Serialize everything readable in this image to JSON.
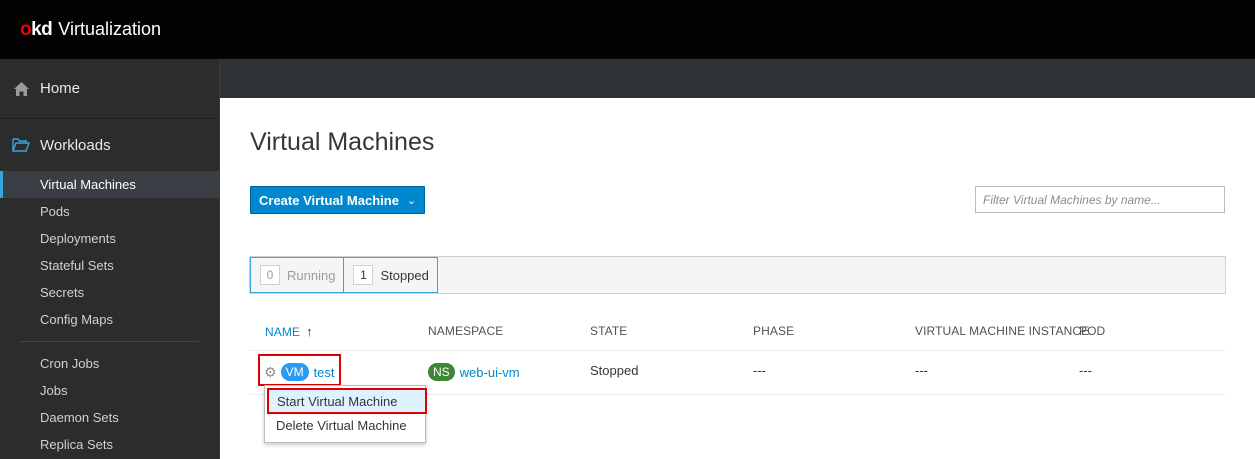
{
  "header": {
    "logo_o": "o",
    "logo_kd": "kd",
    "app_name": "Virtualization"
  },
  "sidebar": {
    "home": "Home",
    "workloads": "Workloads",
    "items": [
      "Virtual Machines",
      "Pods",
      "Deployments",
      "Stateful Sets",
      "Secrets",
      "Config Maps"
    ],
    "items2": [
      "Cron Jobs",
      "Jobs",
      "Daemon Sets",
      "Replica Sets"
    ]
  },
  "main": {
    "title": "Virtual Machines",
    "create_button": "Create Virtual Machine",
    "filter_placeholder": "Filter Virtual Machines by name...",
    "status": {
      "running_count": "0",
      "running_label": "Running",
      "stopped_count": "1",
      "stopped_label": "Stopped"
    },
    "columns": [
      "NAME",
      "NAMESPACE",
      "STATE",
      "PHASE",
      "VIRTUAL MACHINE INSTANCE",
      "POD"
    ],
    "sort_arrow": "↑",
    "rows": [
      {
        "vm_badge": "VM",
        "name": "test",
        "ns_badge": "NS",
        "namespace": "web-ui-vm",
        "state": "Stopped",
        "phase": "---",
        "vmi": "---",
        "pod": "---"
      }
    ]
  },
  "menu": {
    "items": [
      "Start Virtual Machine",
      "Delete Virtual Machine"
    ]
  },
  "colors": {
    "accent": "#0088ce",
    "highlight": "#e00000",
    "masthead": "#030303",
    "sidebar": "#2c2c2c"
  }
}
